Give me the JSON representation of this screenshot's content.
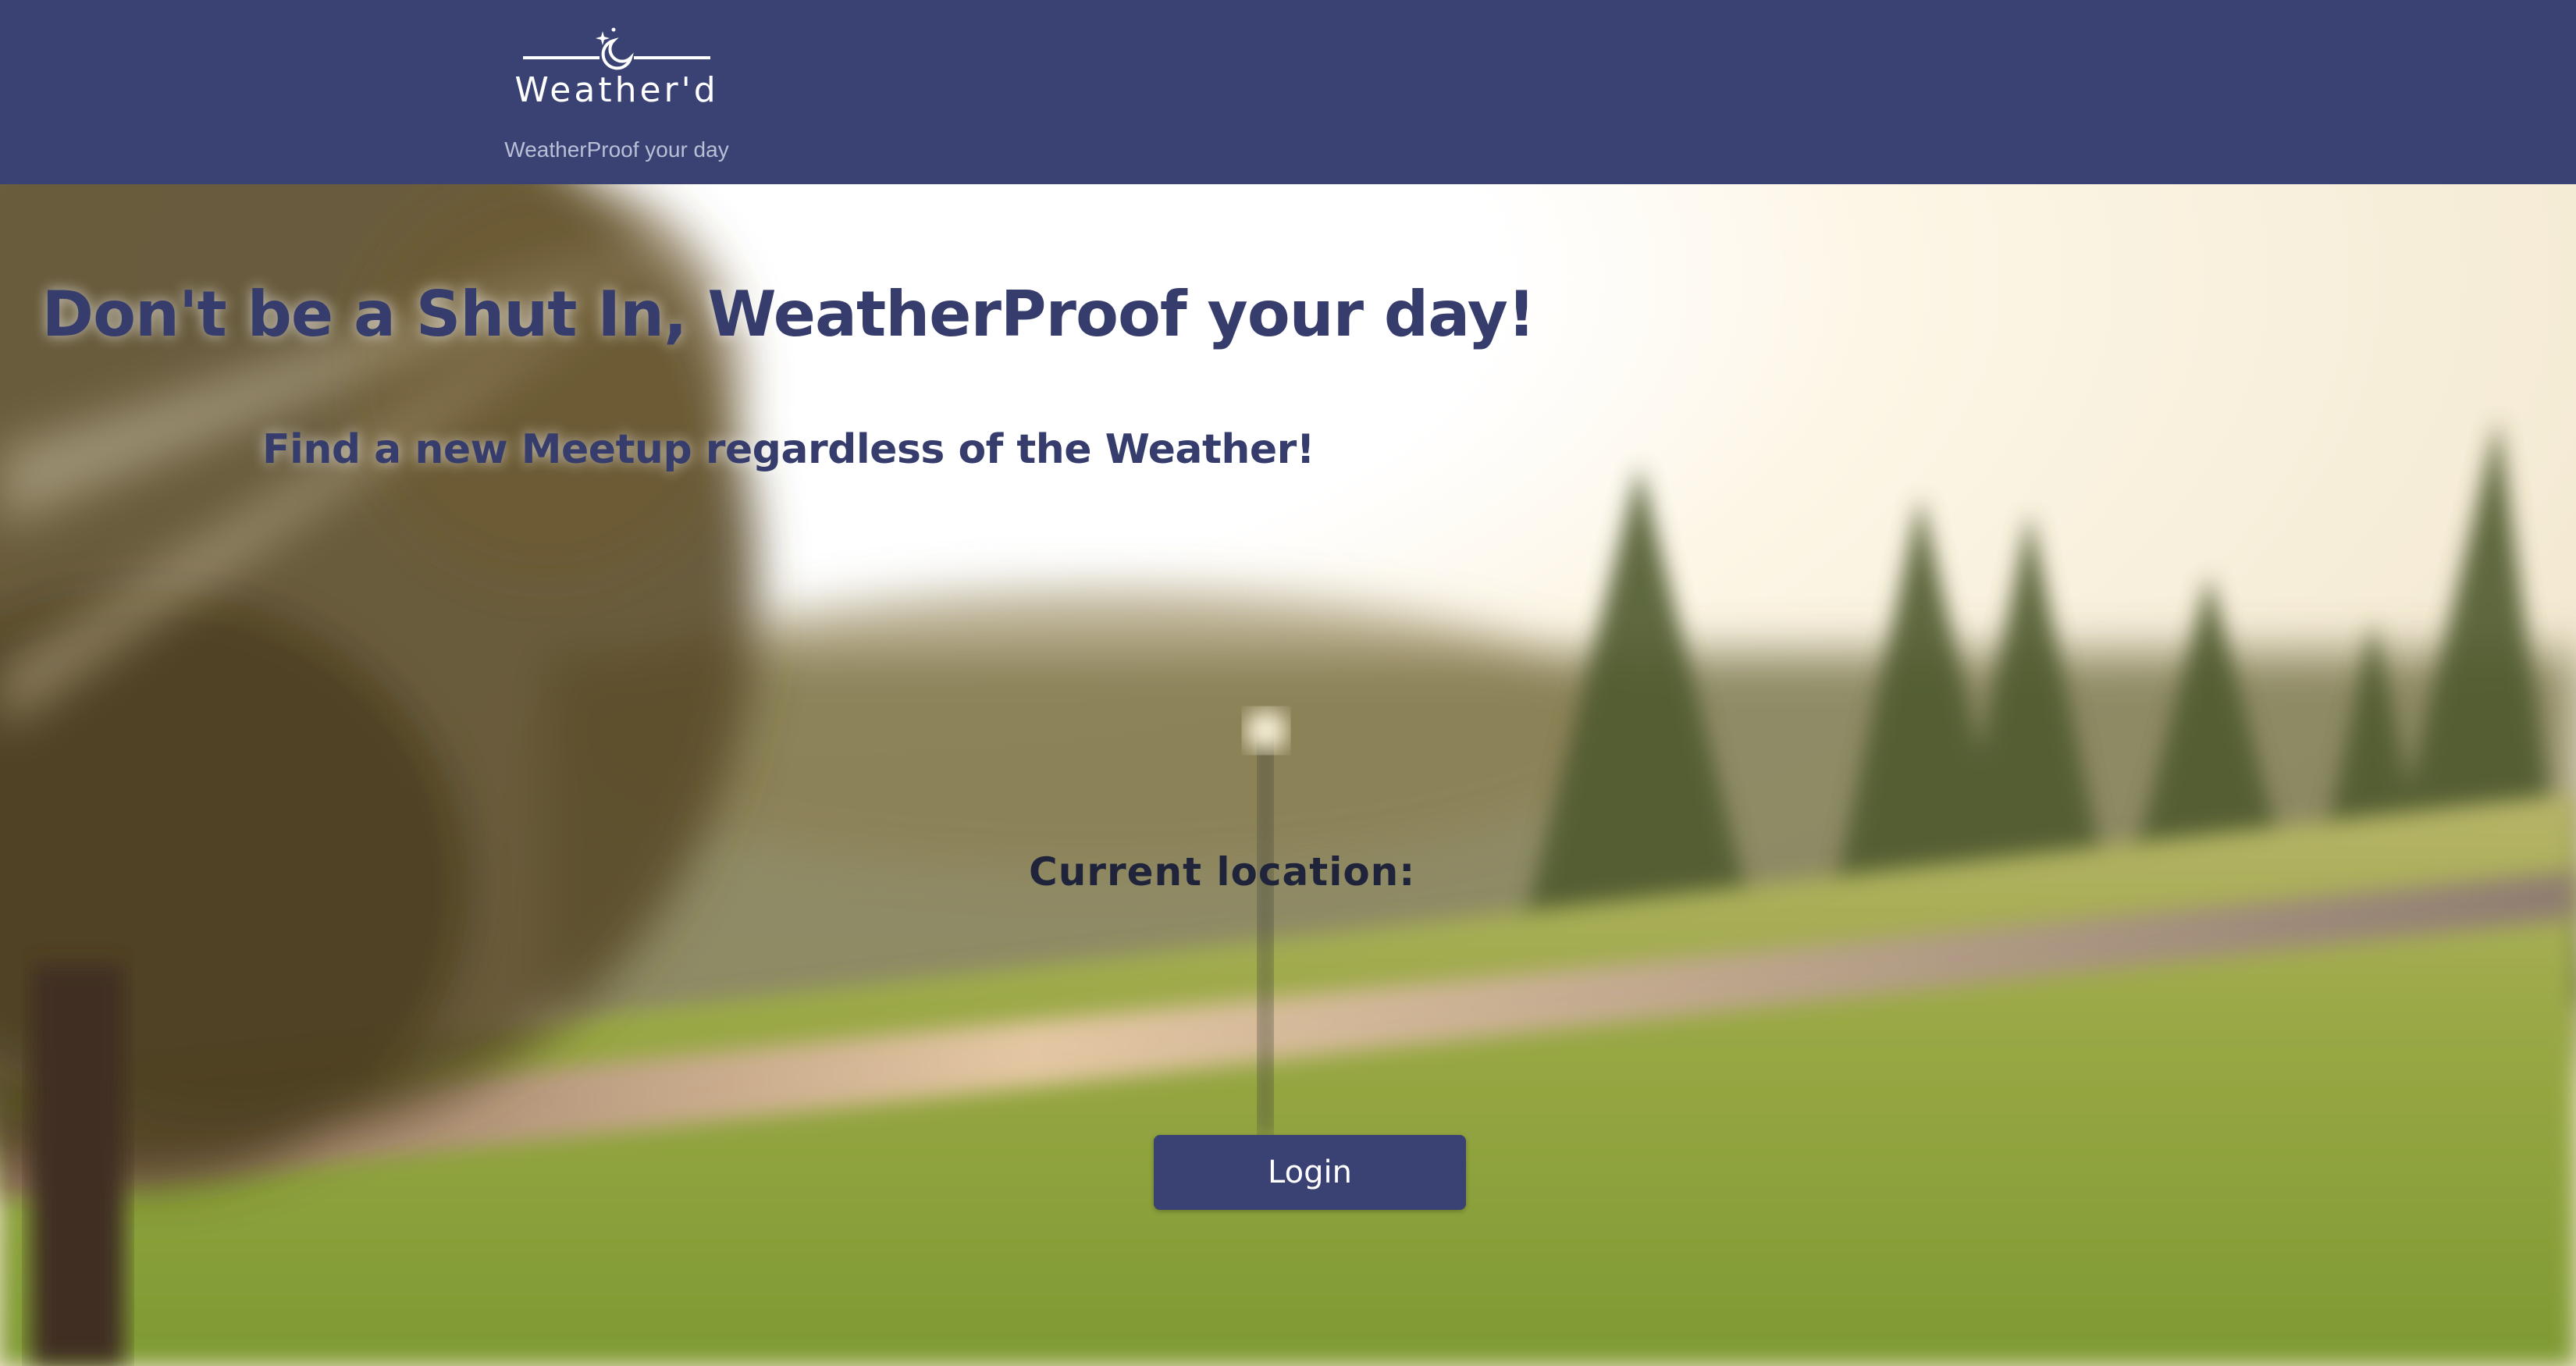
{
  "brand": {
    "name": "Weather'd",
    "tagline": "WeatherProof your day",
    "logo_icon": "moon-sparkle-icon"
  },
  "hero": {
    "headline": "Don't be a Shut In, WeatherProof your day!",
    "subheadline": "Find a new Meetup regardless of the Weather!",
    "background": "sunlit-park-photo"
  },
  "location": {
    "label": "Current location:",
    "value": ""
  },
  "actions": {
    "login_label": "Login"
  },
  "colors": {
    "nav_bg": "#3a4273",
    "heading": "#363d6c",
    "button_bg": "#3a4273"
  }
}
